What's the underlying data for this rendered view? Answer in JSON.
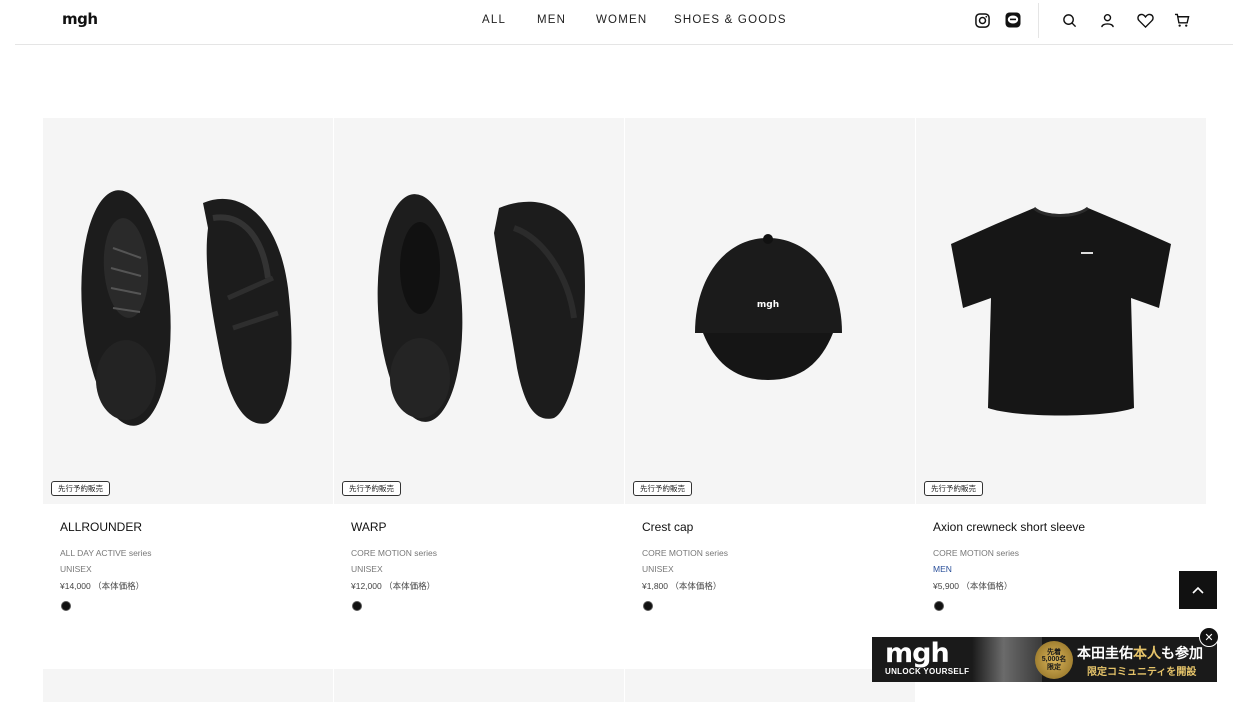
{
  "header": {
    "logo": "mgh",
    "nav": [
      "ALL",
      "MEN",
      "WOMEN",
      "SHOES & GOODS"
    ]
  },
  "products": [
    {
      "name": "ALLROUNDER",
      "series": "ALL DAY ACTIVE series",
      "gender": "UNISEX",
      "price": "¥14,000 （本体価格）",
      "badge": "先行予約販売",
      "color": "#111111",
      "image": "shoe-pair"
    },
    {
      "name": "WARP",
      "series": "CORE MOTION series",
      "gender": "UNISEX",
      "price": "¥12,000 （本体価格）",
      "badge": "先行予約販売",
      "color": "#111111",
      "image": "shoe-pair"
    },
    {
      "name": "Crest cap",
      "series": "CORE MOTION series",
      "gender": "UNISEX",
      "price": "¥1,800 （本体価格）",
      "badge": "先行予約販売",
      "color": "#111111",
      "image": "cap"
    },
    {
      "name": "Axion crewneck short sleeve",
      "series": "CORE MOTION series",
      "gender": "MEN",
      "price": "¥5,900 （本体価格）",
      "badge": "先行予約販売",
      "color": "#111111",
      "image": "t-shirt"
    }
  ],
  "banner": {
    "logo": "mgh",
    "tagline": "UNLOCK YOURSELF",
    "medal_top": "先着",
    "medal_mid": "5,000名",
    "medal_bottom": "限定",
    "main_pre": "本田圭佑",
    "main_gold": "本人",
    "main_post": "も参加",
    "sub": "限定コミュニティを開設"
  },
  "colors": {
    "accent": "#111111",
    "men_label": "#2a4f9a",
    "banner_gold": "#e6c46a"
  }
}
